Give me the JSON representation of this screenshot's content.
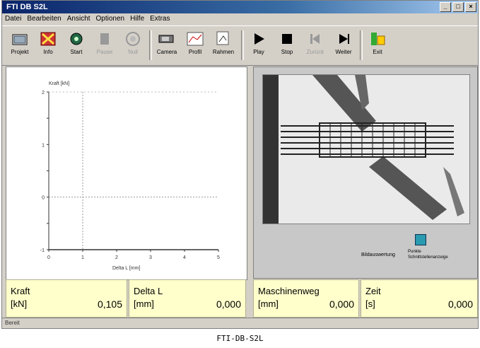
{
  "window": {
    "title": "FTI DB S2L"
  },
  "menu": [
    "Datei",
    "Bearbeiten",
    "Ansicht",
    "Optionen",
    "Hilfe",
    "Extras"
  ],
  "toolbar": [
    {
      "label": "Projekt",
      "icon": "folder-icon",
      "enabled": true
    },
    {
      "label": "Info",
      "icon": "info-icon",
      "enabled": true
    },
    {
      "label": "Start",
      "icon": "gear-icon",
      "enabled": true
    },
    {
      "label": "Pause",
      "icon": "pause-icon",
      "enabled": false
    },
    {
      "label": "Null",
      "icon": "zero-icon",
      "enabled": false
    },
    {
      "label": "Camera",
      "icon": "camera-icon",
      "enabled": true
    },
    {
      "label": "Profil",
      "icon": "profile-icon",
      "enabled": true
    },
    {
      "label": "Rahmen",
      "icon": "frame-icon",
      "enabled": true
    },
    {
      "label": "Play",
      "icon": "play-icon",
      "enabled": true
    },
    {
      "label": "Stop",
      "icon": "stop-icon",
      "enabled": true
    },
    {
      "label": "Zurück",
      "icon": "rewind-icon",
      "enabled": false
    },
    {
      "label": "Weiter",
      "icon": "forward-icon",
      "enabled": true
    },
    {
      "label": "Exit",
      "icon": "exit-icon",
      "enabled": true
    }
  ],
  "chart_data": {
    "type": "line",
    "ylabel": "Kraft [kN]",
    "xlabel": "Delta L [mm]",
    "x_ticks": [
      "0",
      "1",
      "2",
      "3",
      "4",
      "5"
    ],
    "y_ticks": [
      "2",
      "",
      "1",
      "",
      "0",
      "",
      "-1"
    ],
    "xlim": [
      0,
      5
    ],
    "ylim": [
      -1,
      2
    ],
    "series": []
  },
  "image_panel": {
    "button_label": "Bildauswertung",
    "button_caption": "Punkte\nSchnittstellenanzeige"
  },
  "measurements": [
    {
      "label": "Kraft",
      "unit": "[kN]",
      "value": "0,105"
    },
    {
      "label": "Delta L",
      "unit": "[mm]",
      "value": "0,000"
    },
    {
      "label": "Maschinenweg",
      "unit": "[mm]",
      "value": "0,000"
    },
    {
      "label": "Zeit",
      "unit": "[s]",
      "value": "0,000"
    }
  ],
  "statusbar": {
    "text": "Bereit"
  },
  "caption": "FTI-DB-S2L"
}
